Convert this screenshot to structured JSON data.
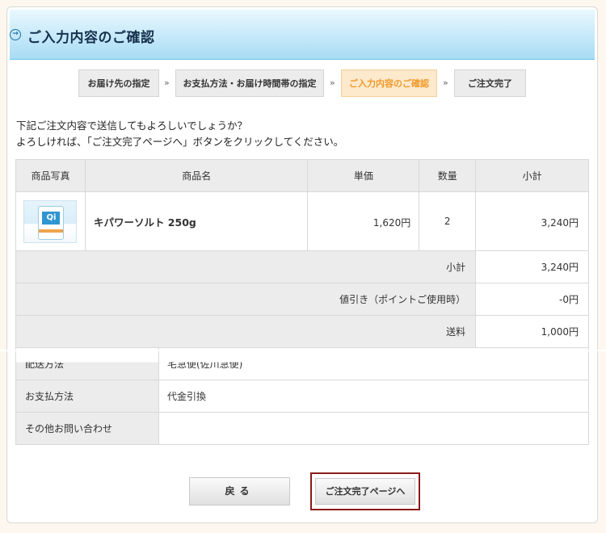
{
  "header": {
    "title": "ご入力内容のご確認",
    "icon": "arrow-circle-icon"
  },
  "steps": [
    {
      "label": "お届け先の指定",
      "active": false
    },
    {
      "label": "お支払方法・お届け時間帯の指定",
      "active": false
    },
    {
      "label": "ご入力内容のご確認",
      "active": true
    },
    {
      "label": "ご注文完了",
      "active": false
    }
  ],
  "step_separator": "»",
  "message": {
    "line1": "下記ご注文内容で送信してもよろしいでしょうか？",
    "line2": "よろしければ、「ご注文完了ページへ」ボタンをクリックしてください。"
  },
  "order_table": {
    "headers": {
      "photo": "商品写真",
      "name": "商品名",
      "price": "単価",
      "qty": "数量",
      "subtotal": "小計"
    },
    "items": [
      {
        "name": "キパワーソルト 250g",
        "price": "1,620円",
        "qty": "2",
        "subtotal": "3,240円",
        "image_label": "Qi"
      }
    ],
    "summary": {
      "subtotal_label": "小計",
      "subtotal_value": "3,240円",
      "discount_label": "値引き（ポイントご使用時）",
      "discount_value": "-0円",
      "shipping_label": "送料",
      "shipping_value": "1,000円"
    }
  },
  "info_table": {
    "delivery_label": "配送方法",
    "delivery_value": "宅急便(佐川急便)",
    "payment_label": "お支払方法",
    "payment_value": "代金引換",
    "inquiry_label": "その他お問い合わせ",
    "inquiry_value": ""
  },
  "buttons": {
    "back": "戻る",
    "next": "ご注文完了ページへ"
  },
  "colors": {
    "accent": "#f09a2b",
    "header_bg": "#a8dcf4",
    "highlight_border": "#8a1a1a"
  }
}
